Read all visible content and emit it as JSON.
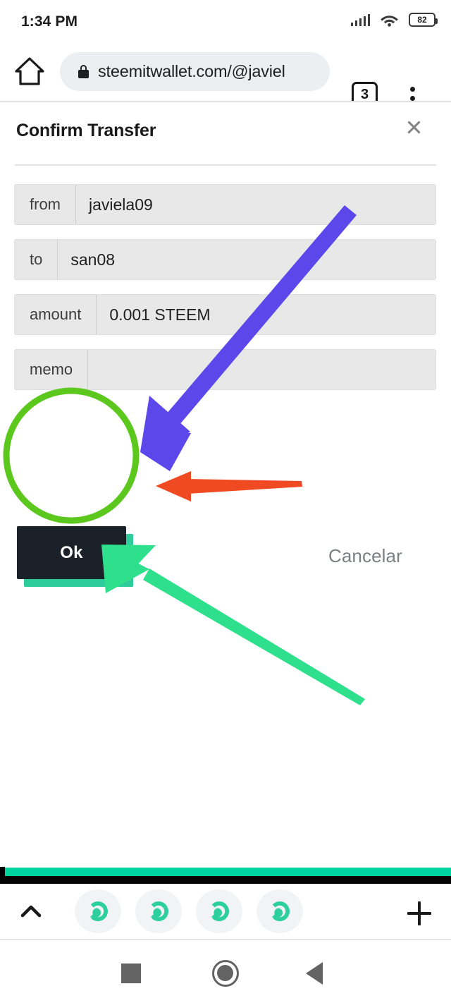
{
  "status_bar": {
    "time": "1:34 PM",
    "battery_level": "82",
    "signal_icon": "cellular-signal-icon",
    "wifi_icon": "wifi-icon",
    "battery_icon": "battery-icon"
  },
  "browser": {
    "home_icon": "home-icon",
    "lock_icon": "lock-icon",
    "url": "steemitwallet.com/@javiel",
    "tab_count": "3",
    "menu_icon": "kebab-menu-icon"
  },
  "modal": {
    "title": "Confirm Transfer",
    "close_icon": "close-icon",
    "fields": [
      {
        "label": "from",
        "value": "javiela09"
      },
      {
        "label": "to",
        "value": "san08"
      },
      {
        "label": "amount",
        "value": "0.001 STEEM"
      },
      {
        "label": "memo",
        "value": ""
      }
    ],
    "ok_label": "Ok",
    "cancel_label": "Cancelar"
  },
  "annotations": {
    "highlight_circle": {
      "color": "#5cc81e",
      "target": "ok-button"
    },
    "purple_arrow": {
      "color": "#5b47ea",
      "points_to": "ok-button"
    },
    "red_arrow": {
      "color": "#f04a22",
      "points_to": "ok-button"
    },
    "green_arrow": {
      "color": "#2ee08c",
      "points_to": "ok-button"
    },
    "blue_tab_circle": {
      "color": "#1453b8",
      "target": "tab-3"
    },
    "blue_close_badge": {
      "color": "#1453b8",
      "icon": "close-icon"
    }
  },
  "tab_strip": {
    "chevron_icon": "chevron-up-icon",
    "add_icon": "plus-icon",
    "tabs": [
      {
        "icon": "steem-logo-icon"
      },
      {
        "icon": "steem-logo-icon"
      },
      {
        "icon": "steem-logo-icon"
      },
      {
        "icon": "steem-logo-icon"
      }
    ]
  },
  "nav_bar": {
    "recents_icon": "square-recents-icon",
    "home_icon": "circle-home-icon",
    "back_icon": "triangle-back-icon"
  },
  "colors": {
    "teal_accent": "#00d5a0",
    "button_dark": "#1b2129",
    "field_bg": "#e8e8e8"
  }
}
